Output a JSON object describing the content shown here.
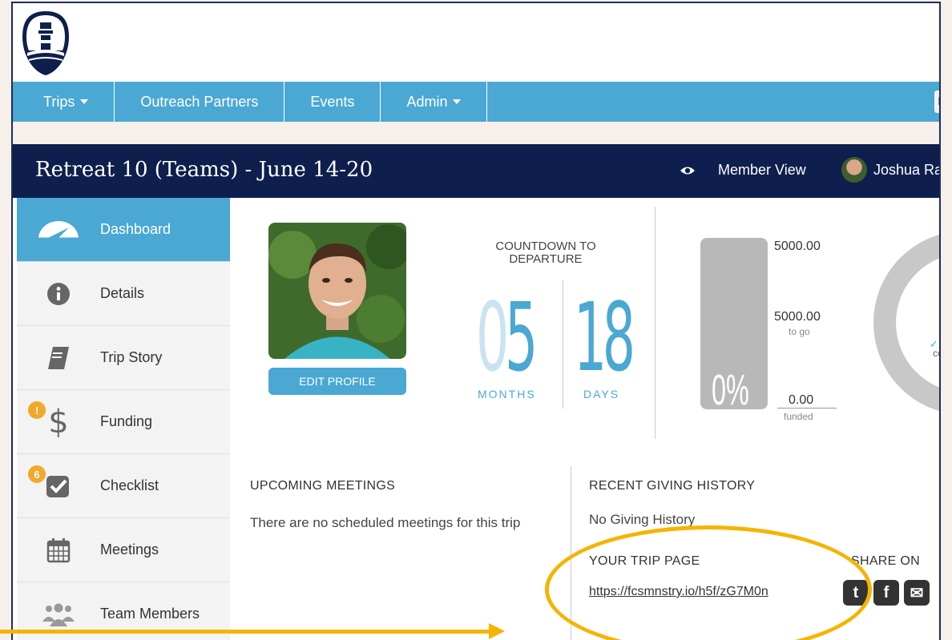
{
  "nav": {
    "items": [
      {
        "label": "Trips",
        "dropdown": true
      },
      {
        "label": "Outreach Partners",
        "dropdown": false
      },
      {
        "label": "Events",
        "dropdown": false
      },
      {
        "label": "Admin",
        "dropdown": true
      }
    ],
    "search_fragment": "F"
  },
  "header": {
    "title": "Retreat 10 (Teams) - June 14-20",
    "member_view_label": "Member View",
    "user_name": "Joshua Ra"
  },
  "sidebar": {
    "items": [
      {
        "label": "Dashboard",
        "icon": "speedometer-icon",
        "active": true
      },
      {
        "label": "Details",
        "icon": "info-icon"
      },
      {
        "label": "Trip Story",
        "icon": "book-icon"
      },
      {
        "label": "Funding",
        "icon": "dollar-icon",
        "badge": "!"
      },
      {
        "label": "Checklist",
        "icon": "checkbox-icon",
        "badge": "6"
      },
      {
        "label": "Meetings",
        "icon": "calendar-icon"
      },
      {
        "label": "Team Members",
        "icon": "team-icon"
      }
    ]
  },
  "profile": {
    "edit_label": "EDIT PROFILE"
  },
  "countdown": {
    "title": "COUNTDOWN TO DEPARTURE",
    "months": "05",
    "months_label": "MONTHS",
    "days": "18",
    "days_label": "DAYS"
  },
  "funding": {
    "goal": "5000.00",
    "to_go": "5000.00",
    "to_go_label": "to go",
    "funded": "0.00",
    "funded_label": "funded",
    "percent": "0%",
    "percent_value": 0
  },
  "ring": {
    "fragment": "co"
  },
  "meetings": {
    "heading": "UPCOMING MEETINGS",
    "empty_text": "There are no scheduled meetings for this trip"
  },
  "giving": {
    "heading": "RECENT GIVING HISTORY",
    "empty_text": "No Giving History"
  },
  "trip_page": {
    "heading": "YOUR TRIP PAGE",
    "url": "https://fcsmnstry.io/h5f/zG7M0n",
    "share_heading": "SHARE ON"
  },
  "colors": {
    "nav_bg": "#4aa8d3",
    "header_bg": "#0e1f4d",
    "annotation": "#f5b400",
    "badge": "#f1a82b"
  }
}
